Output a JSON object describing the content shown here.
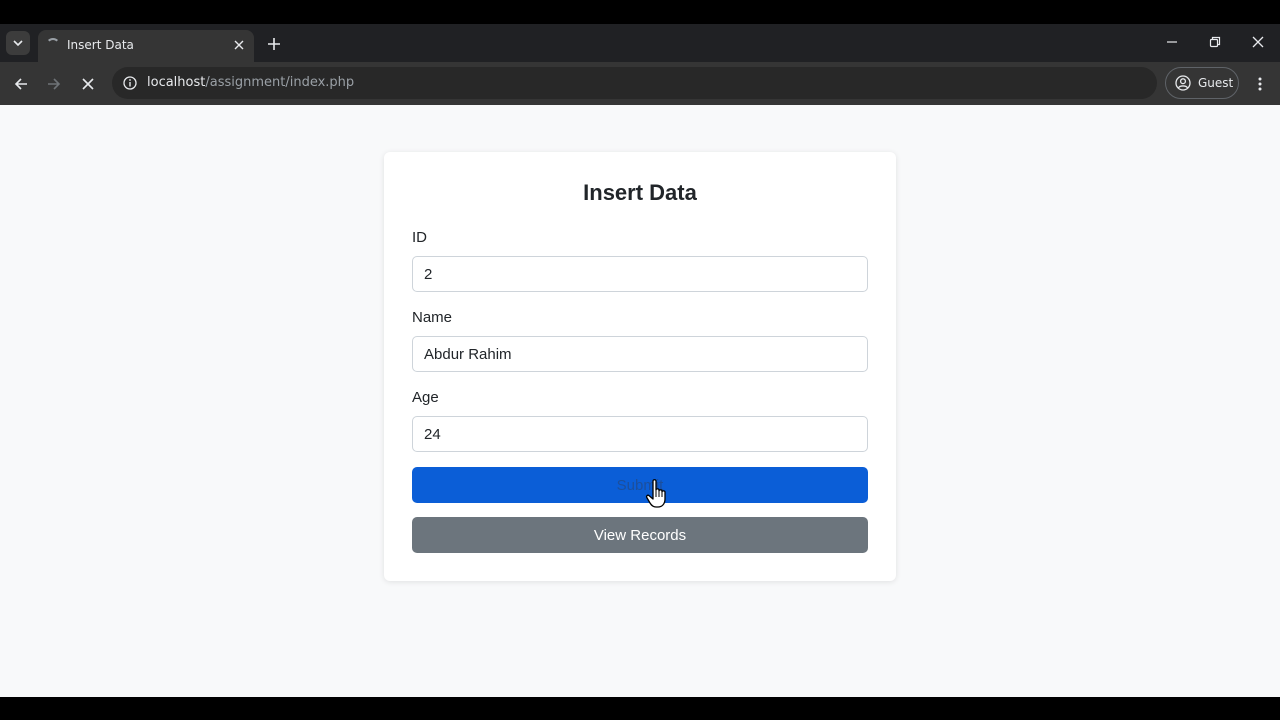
{
  "browser": {
    "tab_title": "Insert Data",
    "url_host": "localhost",
    "url_path": "/assignment/index.php",
    "profile_label": "Guest",
    "icons": [
      "tab-list-icon",
      "loading-spinner-icon",
      "close-icon",
      "plus-icon",
      "minimize-icon",
      "restore-icon",
      "close-window-icon",
      "back-arrow-icon",
      "forward-arrow-icon",
      "stop-icon",
      "site-info-icon",
      "profile-icon",
      "kebab-menu-icon"
    ]
  },
  "form": {
    "title": "Insert Data",
    "fields": [
      {
        "label": "ID",
        "value": "2"
      },
      {
        "label": "Name",
        "value": "Abdur Rahim"
      },
      {
        "label": "Age",
        "value": "24"
      }
    ],
    "submit_label": "Submit",
    "view_records_label": "View Records"
  },
  "colors": {
    "primary": "#0b5ed7",
    "secondary": "#6c757d",
    "page_bg": "#f8f9fa"
  }
}
